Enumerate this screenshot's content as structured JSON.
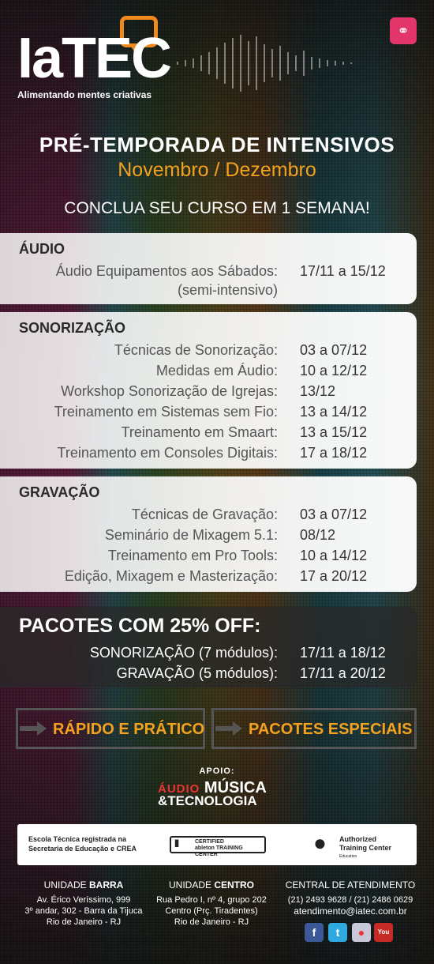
{
  "header": {
    "logo_text": "IaTEC",
    "tagline": "Alimentando mentes criativas",
    "title": "PRÉ-TEMPORADA DE INTENSIVOS",
    "subtitle": "Novembro / Dezembro",
    "headline": "CONCLUA SEU CURSO EM 1 SEMANA!"
  },
  "sections": {
    "audio": {
      "title": "ÁUDIO",
      "rows": [
        {
          "label": "Áudio Equipamentos aos Sábados:",
          "date": "17/11 a 15/12"
        },
        {
          "label": "(semi-intensivo)",
          "date": ""
        }
      ]
    },
    "sonorizacao": {
      "title": "SONORIZAÇÃO",
      "rows": [
        {
          "label": "Técnicas de Sonorização:",
          "date": "03 a 07/12"
        },
        {
          "label": "Medidas em Áudio:",
          "date": "10 a 12/12"
        },
        {
          "label": "Workshop Sonorização de Igrejas:",
          "date": "13/12"
        },
        {
          "label": "Treinamento em Sistemas sem Fio:",
          "date": "13 a 14/12"
        },
        {
          "label": "Treinamento em Smaart:",
          "date": "13 a 15/12"
        },
        {
          "label": "Treinamento em Consoles Digitais:",
          "date": "17 a 18/12"
        }
      ]
    },
    "gravacao": {
      "title": "GRAVAÇÃO",
      "rows": [
        {
          "label": "Técnicas de Gravação:",
          "date": "03 a 07/12"
        },
        {
          "label": "Seminário de Mixagem 5.1:",
          "date": "08/12"
        },
        {
          "label": "Treinamento em Pro Tools:",
          "date": "10 a 14/12"
        },
        {
          "label": "Edição, Mixagem e Masterização:",
          "date": "17 a 20/12"
        }
      ]
    }
  },
  "pacotes": {
    "title": "PACOTES COM 25% OFF:",
    "rows": [
      {
        "name": "SONORIZAÇÃO",
        "detail": "(7 módulos):",
        "date": "17/11 a 18/12"
      },
      {
        "name": "GRAVAÇÃO",
        "detail": "(5 módulos):",
        "date": "17/11 a 20/12"
      }
    ]
  },
  "buttons": {
    "rapido": "RÁPIDO E PRÁTICO",
    "pacotes": "PACOTES ESPECIAIS"
  },
  "apoio": {
    "label": "APOIO:",
    "brand_line1_red": "ÁUDIO",
    "brand_line1": "MÚSICA",
    "brand_line2": "&TECNOLOGIA"
  },
  "certs": {
    "escola_line1": "Escola Técnica registrada na",
    "escola_line2": "Secretaria de Educação e CREA",
    "ableton_line1": "CERTIFIED",
    "ableton_line2": "TRAINING CENTER",
    "ableton_brand": "ableton",
    "apple_line1": "Authorized",
    "apple_line2": "Training Center",
    "apple_line3": "Education"
  },
  "footer": {
    "barra": {
      "prefix": "UNIDADE ",
      "name": "BARRA",
      "line1": "Av. Érico Veríssimo, 999",
      "line2": "3º andar, 302 - Barra da Tijuca",
      "line3": "Rio de Janeiro - RJ"
    },
    "centro": {
      "prefix": "UNIDADE ",
      "name": "CENTRO",
      "line1": "Rua  Pedro I, nº 4, grupo 202",
      "line2": "Centro (Prç. Tiradentes)",
      "line3": "Rio de Janeiro - RJ"
    },
    "central": {
      "title": "CENTRAL DE ATENDIMENTO",
      "phones": "(21) 2493 9628 / (21) 2486 0629",
      "email": "atendimento@iatec.com.br"
    }
  },
  "social": [
    "facebook-icon",
    "twitter-icon",
    "flickr-icon",
    "youtube-icon"
  ],
  "colors": {
    "accent": "#f4a21e",
    "brand_orange": "#f08a1e",
    "headphones": "#e2356a"
  }
}
